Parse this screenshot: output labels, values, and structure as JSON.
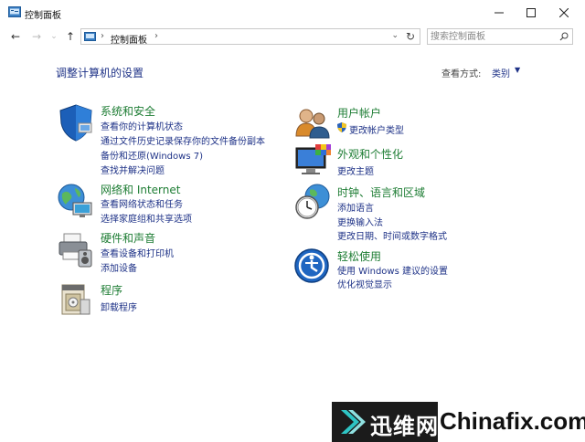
{
  "window": {
    "title": "控制面板",
    "minimize": "—",
    "maximize": "☐",
    "close": "✕"
  },
  "nav": {
    "back": "←",
    "forward": "→",
    "recent": "⌄",
    "up": "↑",
    "address_crumb": "控制面板",
    "separator": "›",
    "refresh": "↻",
    "search_placeholder": "搜索控制面板"
  },
  "heading": "调整计算机的设置",
  "view_by": {
    "label": "查看方式:",
    "value": "类别",
    "caret": "▼"
  },
  "left_column": [
    {
      "icon": "security-shield-icon",
      "title": "系统和安全",
      "links": [
        "查看你的计算机状态",
        "通过文件历史记录保存你的文件备份副本",
        "备份和还原(Windows 7)",
        "查找并解决问题"
      ]
    },
    {
      "icon": "network-globe-icon",
      "title": "网络和 Internet",
      "links": [
        "查看网络状态和任务",
        "选择家庭组和共享选项"
      ]
    },
    {
      "icon": "hardware-printer-icon",
      "title": "硬件和声音",
      "links": [
        "查看设备和打印机",
        "添加设备"
      ]
    },
    {
      "icon": "programs-icon",
      "title": "程序",
      "links": [
        "卸载程序"
      ]
    }
  ],
  "right_column": [
    {
      "icon": "user-accounts-icon",
      "title": "用户帐户",
      "links": [
        "更改帐户类型"
      ]
    },
    {
      "icon": "appearance-monitor-icon",
      "title": "外观和个性化",
      "links": [
        "更改主题"
      ]
    },
    {
      "icon": "clock-region-icon",
      "title": "时钟、语言和区域",
      "links": [
        "添加语言",
        "更换输入法",
        "更改日期、时间或数字格式"
      ]
    },
    {
      "icon": "ease-of-access-icon",
      "title": "轻松使用",
      "links": [
        "使用 Windows 建议的设置",
        "优化视觉显示"
      ]
    }
  ],
  "watermark": {
    "brand1": "迅维网",
    "brand2": "Chinafix.com"
  },
  "colors": {
    "link": "#1e3287",
    "category_title": "#1e7d34",
    "heading": "#1e3287"
  }
}
